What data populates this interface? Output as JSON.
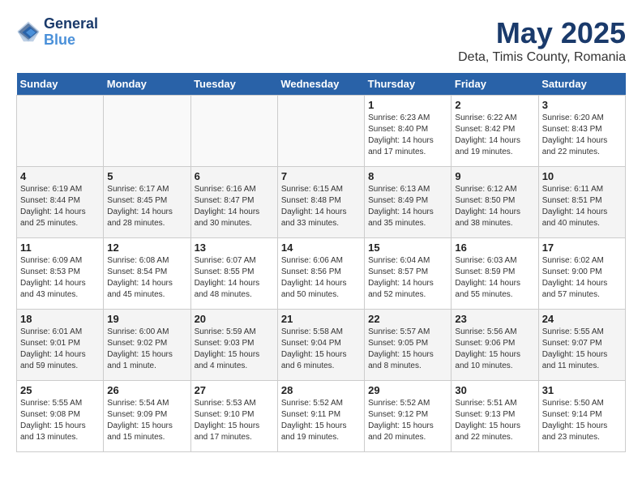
{
  "header": {
    "logo_line1": "General",
    "logo_line2": "Blue",
    "month": "May 2025",
    "location": "Deta, Timis County, Romania"
  },
  "days_of_week": [
    "Sunday",
    "Monday",
    "Tuesday",
    "Wednesday",
    "Thursday",
    "Friday",
    "Saturday"
  ],
  "weeks": [
    [
      {
        "day": "",
        "info": ""
      },
      {
        "day": "",
        "info": ""
      },
      {
        "day": "",
        "info": ""
      },
      {
        "day": "",
        "info": ""
      },
      {
        "day": "1",
        "info": "Sunrise: 6:23 AM\nSunset: 8:40 PM\nDaylight: 14 hours\nand 17 minutes."
      },
      {
        "day": "2",
        "info": "Sunrise: 6:22 AM\nSunset: 8:42 PM\nDaylight: 14 hours\nand 19 minutes."
      },
      {
        "day": "3",
        "info": "Sunrise: 6:20 AM\nSunset: 8:43 PM\nDaylight: 14 hours\nand 22 minutes."
      }
    ],
    [
      {
        "day": "4",
        "info": "Sunrise: 6:19 AM\nSunset: 8:44 PM\nDaylight: 14 hours\nand 25 minutes."
      },
      {
        "day": "5",
        "info": "Sunrise: 6:17 AM\nSunset: 8:45 PM\nDaylight: 14 hours\nand 28 minutes."
      },
      {
        "day": "6",
        "info": "Sunrise: 6:16 AM\nSunset: 8:47 PM\nDaylight: 14 hours\nand 30 minutes."
      },
      {
        "day": "7",
        "info": "Sunrise: 6:15 AM\nSunset: 8:48 PM\nDaylight: 14 hours\nand 33 minutes."
      },
      {
        "day": "8",
        "info": "Sunrise: 6:13 AM\nSunset: 8:49 PM\nDaylight: 14 hours\nand 35 minutes."
      },
      {
        "day": "9",
        "info": "Sunrise: 6:12 AM\nSunset: 8:50 PM\nDaylight: 14 hours\nand 38 minutes."
      },
      {
        "day": "10",
        "info": "Sunrise: 6:11 AM\nSunset: 8:51 PM\nDaylight: 14 hours\nand 40 minutes."
      }
    ],
    [
      {
        "day": "11",
        "info": "Sunrise: 6:09 AM\nSunset: 8:53 PM\nDaylight: 14 hours\nand 43 minutes."
      },
      {
        "day": "12",
        "info": "Sunrise: 6:08 AM\nSunset: 8:54 PM\nDaylight: 14 hours\nand 45 minutes."
      },
      {
        "day": "13",
        "info": "Sunrise: 6:07 AM\nSunset: 8:55 PM\nDaylight: 14 hours\nand 48 minutes."
      },
      {
        "day": "14",
        "info": "Sunrise: 6:06 AM\nSunset: 8:56 PM\nDaylight: 14 hours\nand 50 minutes."
      },
      {
        "day": "15",
        "info": "Sunrise: 6:04 AM\nSunset: 8:57 PM\nDaylight: 14 hours\nand 52 minutes."
      },
      {
        "day": "16",
        "info": "Sunrise: 6:03 AM\nSunset: 8:59 PM\nDaylight: 14 hours\nand 55 minutes."
      },
      {
        "day": "17",
        "info": "Sunrise: 6:02 AM\nSunset: 9:00 PM\nDaylight: 14 hours\nand 57 minutes."
      }
    ],
    [
      {
        "day": "18",
        "info": "Sunrise: 6:01 AM\nSunset: 9:01 PM\nDaylight: 14 hours\nand 59 minutes."
      },
      {
        "day": "19",
        "info": "Sunrise: 6:00 AM\nSunset: 9:02 PM\nDaylight: 15 hours\nand 1 minute."
      },
      {
        "day": "20",
        "info": "Sunrise: 5:59 AM\nSunset: 9:03 PM\nDaylight: 15 hours\nand 4 minutes."
      },
      {
        "day": "21",
        "info": "Sunrise: 5:58 AM\nSunset: 9:04 PM\nDaylight: 15 hours\nand 6 minutes."
      },
      {
        "day": "22",
        "info": "Sunrise: 5:57 AM\nSunset: 9:05 PM\nDaylight: 15 hours\nand 8 minutes."
      },
      {
        "day": "23",
        "info": "Sunrise: 5:56 AM\nSunset: 9:06 PM\nDaylight: 15 hours\nand 10 minutes."
      },
      {
        "day": "24",
        "info": "Sunrise: 5:55 AM\nSunset: 9:07 PM\nDaylight: 15 hours\nand 11 minutes."
      }
    ],
    [
      {
        "day": "25",
        "info": "Sunrise: 5:55 AM\nSunset: 9:08 PM\nDaylight: 15 hours\nand 13 minutes."
      },
      {
        "day": "26",
        "info": "Sunrise: 5:54 AM\nSunset: 9:09 PM\nDaylight: 15 hours\nand 15 minutes."
      },
      {
        "day": "27",
        "info": "Sunrise: 5:53 AM\nSunset: 9:10 PM\nDaylight: 15 hours\nand 17 minutes."
      },
      {
        "day": "28",
        "info": "Sunrise: 5:52 AM\nSunset: 9:11 PM\nDaylight: 15 hours\nand 19 minutes."
      },
      {
        "day": "29",
        "info": "Sunrise: 5:52 AM\nSunset: 9:12 PM\nDaylight: 15 hours\nand 20 minutes."
      },
      {
        "day": "30",
        "info": "Sunrise: 5:51 AM\nSunset: 9:13 PM\nDaylight: 15 hours\nand 22 minutes."
      },
      {
        "day": "31",
        "info": "Sunrise: 5:50 AM\nSunset: 9:14 PM\nDaylight: 15 hours\nand 23 minutes."
      }
    ]
  ]
}
